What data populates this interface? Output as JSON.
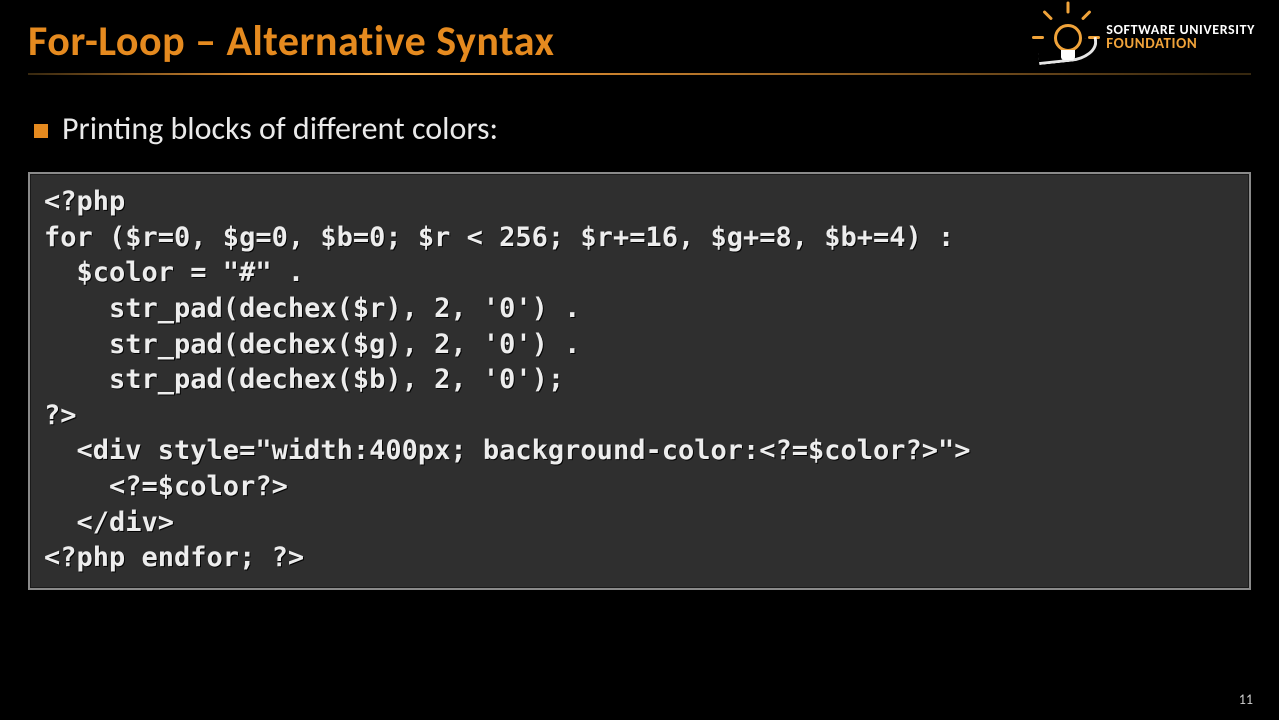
{
  "slide": {
    "title": "For-Loop – Alternative Syntax",
    "bullet": "Printing blocks of different colors:",
    "page_number": "11",
    "code": "<?php\nfor ($r=0, $g=0, $b=0; $r < 256; $r+=16, $g+=8, $b+=4) :\n  $color = \"#\" .\n    str_pad(dechex($r), 2, '0') .\n    str_pad(dechex($g), 2, '0') .\n    str_pad(dechex($b), 2, '0');\n?>\n  <div style=\"width:400px; background-color:<?=$color?>\">\n    <?=$color?>\n  </div>\n<?php endfor; ?>"
  },
  "logo": {
    "line1": "SOFTWARE UNIVERSITY",
    "line2": "FOUNDATION"
  },
  "colors": {
    "accent": "#e58a1f",
    "code_bg": "#2f2f2f",
    "code_border": "#8a8a8a"
  }
}
